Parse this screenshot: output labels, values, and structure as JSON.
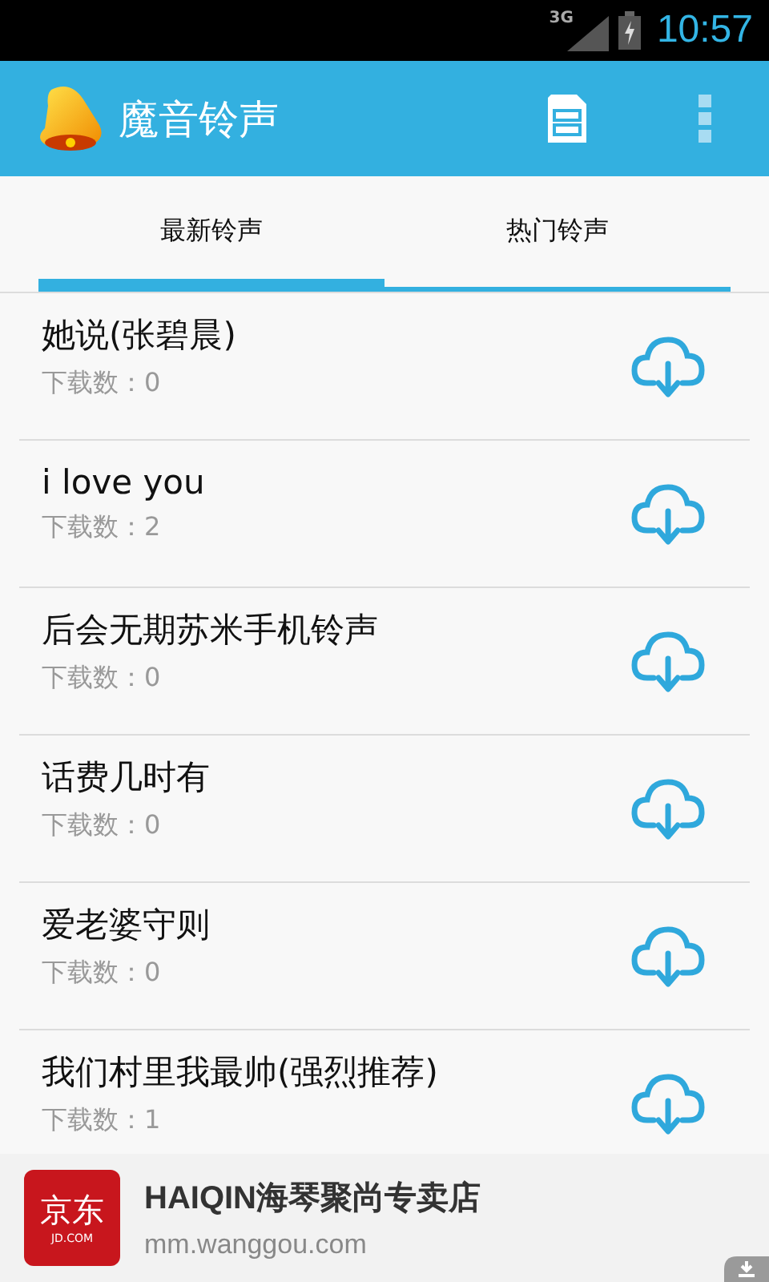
{
  "status_bar": {
    "network": "3G",
    "time": "10:57"
  },
  "app_bar": {
    "title": "魔音铃声"
  },
  "tabs": [
    {
      "label": "最新铃声",
      "selected": true
    },
    {
      "label": "热门铃声",
      "selected": false
    }
  ],
  "ringtones": [
    {
      "title": "她说(张碧晨)",
      "downloads": "下载数：0"
    },
    {
      "title": "i love you",
      "downloads": "下载数：2"
    },
    {
      "title": "后会无期苏米手机铃声",
      "downloads": "下载数：0"
    },
    {
      "title": "话费几时有",
      "downloads": "下载数：0"
    },
    {
      "title": "爱老婆守则",
      "downloads": "下载数：0"
    },
    {
      "title": "我们村里我最帅(强烈推荐)",
      "downloads": "下载数：1"
    }
  ],
  "ad": {
    "logo_text": "京东",
    "logo_subtext": "JD.COM",
    "title": "HAIQIN海琴聚尚专卖店",
    "url": "mm.wanggou.com"
  }
}
